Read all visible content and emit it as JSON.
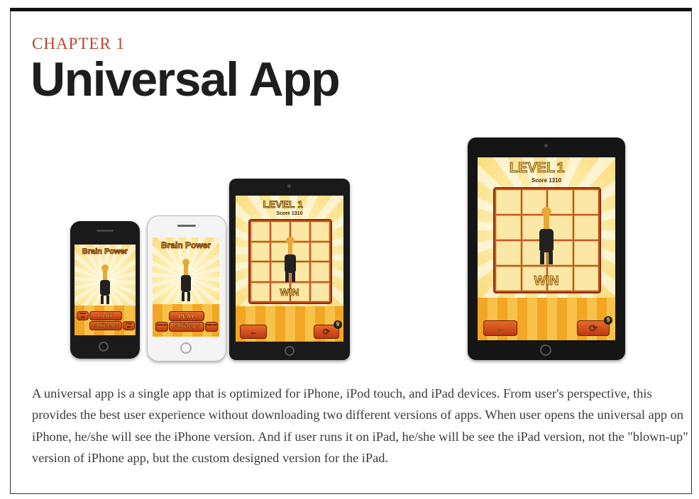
{
  "chapter": "CHAPTER 1",
  "title": "Universal App",
  "game": {
    "title": "Brain Power",
    "level_label": "LEVEL",
    "level_num": "1",
    "score": "Score 1310",
    "play": "PLAY",
    "multiplayer": "Multiplayer",
    "power_ups": "Power ups",
    "win": "WIN",
    "back_icon": "arrow-left",
    "replay_icon": "replay",
    "badge": "9"
  },
  "body": "A universal app is a single app that is optimized for iPhone, iPod touch, and iPad devices. From user's perspective, this provides the best user experience without downloading two different versions of apps. When user opens the universal app on iPhone, he/she will see the iPhone version. And if user runs it on iPad, he/she will be see the iPad version, not the \"blown-up\" version of iPhone app, but the custom designed version for the iPad.",
  "colors": {
    "chapter": "#b8462e",
    "title": "#1e1e1e",
    "body": "#3a3a3a",
    "frame_top": "#111111"
  }
}
